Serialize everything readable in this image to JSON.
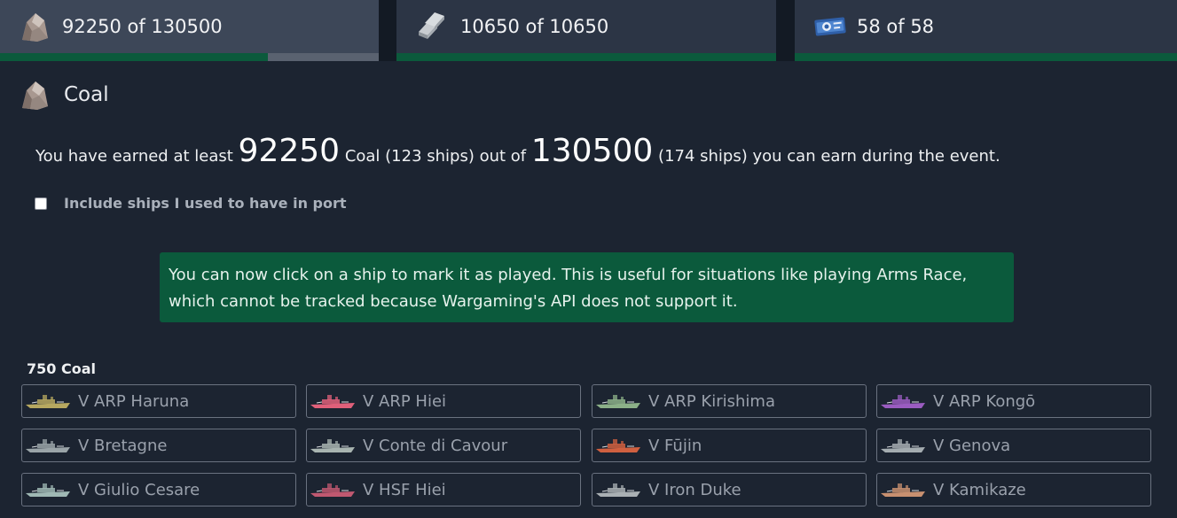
{
  "tabs": [
    {
      "text": "92250 of 130500",
      "icon": "coal-icon",
      "progress": 0.707
    },
    {
      "text": "10650 of 10650",
      "icon": "steel-icon",
      "progress": 1.0
    },
    {
      "text": "58 of 58",
      "icon": "ticket-icon",
      "progress": 1.0
    }
  ],
  "section": {
    "title": "Coal",
    "icon": "coal-icon"
  },
  "summary": {
    "prefix": "You have earned at least",
    "earned": "92250",
    "mid": "Coal (123 ships) out of",
    "total": "130500",
    "suffix": "(174 ships) you can earn during the event."
  },
  "checkbox": {
    "label": "Include ships I used to have in port",
    "checked": false
  },
  "notice": "You can now click on a ship to mark it as played. This is useful for situations like playing Arms Race, which cannot be tracked because Wargaming's API does not support it.",
  "group": {
    "label": "750 Coal",
    "ships": [
      {
        "name": "V ARP Haruna",
        "color": "#b7a860"
      },
      {
        "name": "V ARP Hiei",
        "color": "#e0607a"
      },
      {
        "name": "V ARP Kirishima",
        "color": "#8cb088"
      },
      {
        "name": "V ARP Kongō",
        "color": "#9a5cc0"
      },
      {
        "name": "V Bretagne",
        "color": "#9aa4a8"
      },
      {
        "name": "V Conte di Cavour",
        "color": "#a8b4b0"
      },
      {
        "name": "V Fūjin",
        "color": "#d06040"
      },
      {
        "name": "V Genova",
        "color": "#a4acb0"
      },
      {
        "name": "V Giulio Cesare",
        "color": "#9fb8b4"
      },
      {
        "name": "V HSF Hiei",
        "color": "#c05870"
      },
      {
        "name": "V Iron Duke",
        "color": "#aab0b4"
      },
      {
        "name": "V Kamikaze",
        "color": "#c89070"
      }
    ]
  }
}
